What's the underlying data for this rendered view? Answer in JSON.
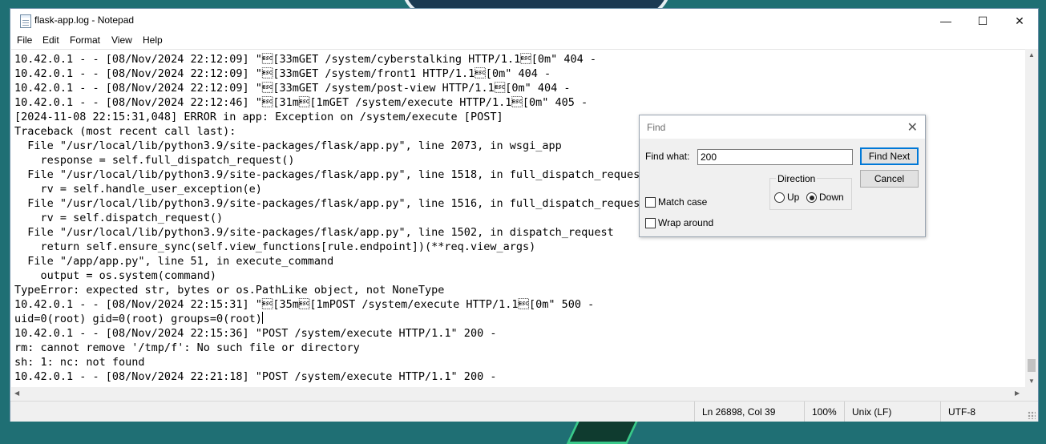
{
  "window": {
    "title": "flask-app.log - Notepad",
    "controls": {
      "minimize": "—",
      "maximize": "☐",
      "close": "✕"
    }
  },
  "menu": [
    "File",
    "Edit",
    "Format",
    "View",
    "Help"
  ],
  "editor": {
    "lines": [
      "10.42.0.1 - - [08/Nov/2024 22:12:09] \"\u001b[33mGET /system/cyberstalking HTTP/1.1\u001b[0m\" 404 -",
      "10.42.0.1 - - [08/Nov/2024 22:12:09] \"\u001b[33mGET /system/front1 HTTP/1.1\u001b[0m\" 404 -",
      "10.42.0.1 - - [08/Nov/2024 22:12:09] \"\u001b[33mGET /system/post-view HTTP/1.1\u001b[0m\" 404 -",
      "10.42.0.1 - - [08/Nov/2024 22:12:46] \"\u001b[31m\u001b[1mGET /system/execute HTTP/1.1\u001b[0m\" 405 -",
      "[2024-11-08 22:15:31,048] ERROR in app: Exception on /system/execute [POST]",
      "Traceback (most recent call last):",
      "  File \"/usr/local/lib/python3.9/site-packages/flask/app.py\", line 2073, in wsgi_app",
      "    response = self.full_dispatch_request()",
      "  File \"/usr/local/lib/python3.9/site-packages/flask/app.py\", line 1518, in full_dispatch_request",
      "    rv = self.handle_user_exception(e)",
      "  File \"/usr/local/lib/python3.9/site-packages/flask/app.py\", line 1516, in full_dispatch_request",
      "    rv = self.dispatch_request()",
      "  File \"/usr/local/lib/python3.9/site-packages/flask/app.py\", line 1502, in dispatch_request",
      "    return self.ensure_sync(self.view_functions[rule.endpoint])(**req.view_args)",
      "  File \"/app/app.py\", line 51, in execute_command",
      "    output = os.system(command)",
      "TypeError: expected str, bytes or os.PathLike object, not NoneType",
      "10.42.0.1 - - [08/Nov/2024 22:15:31] \"\u001b[35m\u001b[1mPOST /system/execute HTTP/1.1\u001b[0m\" 500 -",
      "uid=0(root) gid=0(root) groups=0(root)",
      "10.42.0.1 - - [08/Nov/2024 22:15:36] \"POST /system/execute HTTP/1.1\" 200 -",
      "rm: cannot remove '/tmp/f': No such file or directory",
      "sh: 1: nc: not found",
      "10.42.0.1 - - [08/Nov/2024 22:21:18] \"POST /system/execute HTTP/1.1\" 200 -"
    ],
    "caret_line": 18
  },
  "status": {
    "position": "Ln 26898, Col 39",
    "zoom": "100%",
    "line_ending": "Unix (LF)",
    "encoding": "UTF-8"
  },
  "find_dialog": {
    "title": "Find",
    "find_what_label": "Find what:",
    "find_what_value": "200",
    "find_next": "Find Next",
    "cancel": "Cancel",
    "direction_label": "Direction",
    "up": "Up",
    "down": "Down",
    "direction_selected": "Down",
    "match_case": "Match case",
    "match_case_checked": false,
    "wrap_around": "Wrap around",
    "wrap_around_checked": false
  }
}
